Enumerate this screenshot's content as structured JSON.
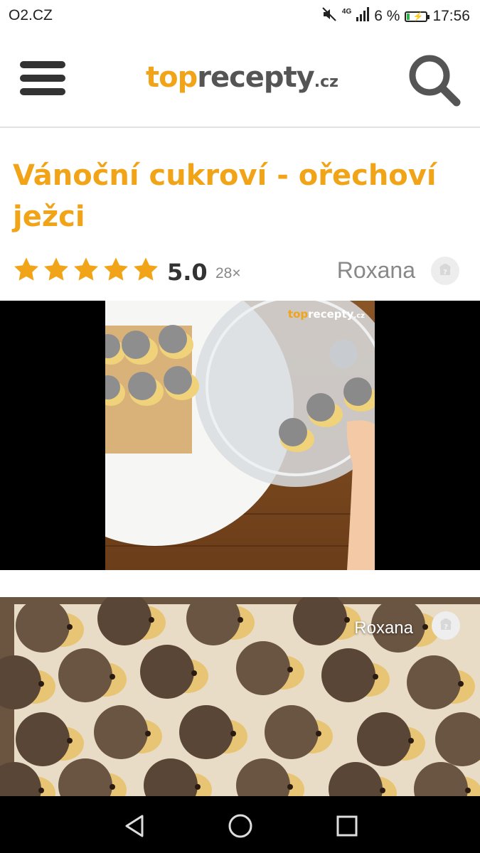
{
  "status_bar": {
    "carrier": "O2.CZ",
    "network": "4G",
    "battery": "6 %",
    "time": "17:56",
    "icons": [
      "mute-icon",
      "signal-icon",
      "battery-charging-icon"
    ]
  },
  "header": {
    "logo_top": "top",
    "logo_recepty": "recepty",
    "logo_cz": ".cz",
    "icons": [
      "hamburger-menu-icon",
      "search-icon"
    ]
  },
  "recipe": {
    "title": "Vánoční cukroví - ořechoví ježci",
    "rating_value": 5.0,
    "rating_label": "5.0",
    "rating_count": "28×",
    "stars": 5,
    "author": "Roxana"
  },
  "video": {
    "watermark_top": "top",
    "watermark_rest": "recepty",
    "watermark_cz": ".cz"
  },
  "photo": {
    "author": "Roxana"
  },
  "nav_bar": {
    "icons": [
      "back-icon",
      "home-icon",
      "recents-icon"
    ]
  },
  "colors": {
    "accent": "#f1a417",
    "text_dark": "#333333",
    "text_muted": "#888888",
    "star": "#f1a417"
  }
}
